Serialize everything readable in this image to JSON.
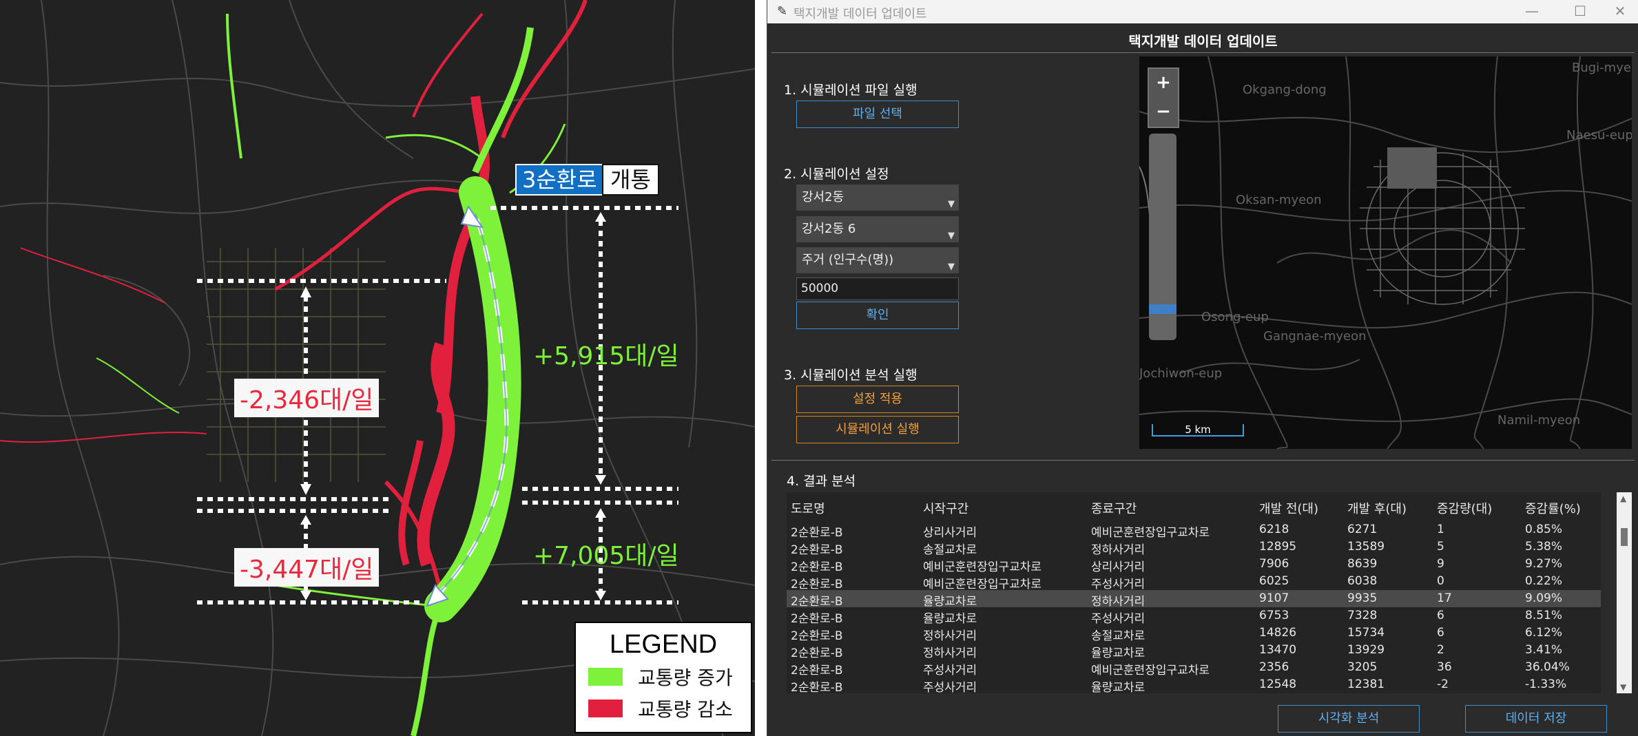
{
  "traffic_map": {
    "callout_route_name": "3순환로",
    "callout_status": "개통",
    "increase_north": "+5,915대/일",
    "increase_south": "+7,005대/일",
    "decrease_north": "-2,346대/일",
    "decrease_south": "-3,447대/일",
    "legend": {
      "title": "LEGEND",
      "increase_label": "교통량 증가",
      "decrease_label": "교통량 감소",
      "increase_color": "#7ef23a",
      "decrease_color": "#e0203c"
    }
  },
  "window": {
    "title": "택지개발 데이터 업데이트",
    "header": "택지개발 데이터 업데이트",
    "controls": [
      "—",
      "☐",
      "✕"
    ]
  },
  "step1": {
    "label": "1. 시뮬레이션 파일 실행",
    "button": "파일 선택"
  },
  "step2": {
    "label": "2. 시뮬레이션 설정",
    "dropdown1": "강서2동",
    "dropdown2": "강서2동 6",
    "dropdown3": "주거 (인구수(명))",
    "input_value": "50000",
    "confirm_button": "확인"
  },
  "step3": {
    "label": "3. 시뮬레이션 분석 실행",
    "apply_button": "설정 적용",
    "run_button": "시뮬레이션 실행"
  },
  "map_panel": {
    "zoom_in": "+",
    "zoom_out": "−",
    "scale": "5 km",
    "place_labels": [
      "Bugi-myeon",
      "Okgang-dong",
      "Naesu-eup",
      "Oksan-myeon",
      "Osong-eup",
      "Gangnae-myeon",
      "Jochiwon-eup",
      "Namil-myeon"
    ]
  },
  "results": {
    "label": "4. 결과 분석",
    "headers": [
      "도로명",
      "시작구간",
      "종료구간",
      "개발 전(대)",
      "개발 후(대)",
      "증감량(대)",
      "증감률(%)"
    ],
    "rows": [
      [
        "2순환로-B",
        "상리사거리",
        "예비군훈련장입구교차로",
        "6218",
        "6271",
        "1",
        "0.85%"
      ],
      [
        "2순환로-B",
        "송절교차로",
        "정하사거리",
        "12895",
        "13589",
        "5",
        "5.38%"
      ],
      [
        "2순환로-B",
        "예비군훈련장입구교차로",
        "상리사거리",
        "7906",
        "8639",
        "9",
        "9.27%"
      ],
      [
        "2순환로-B",
        "예비군훈련장입구교차로",
        "주성사거리",
        "6025",
        "6038",
        "0",
        "0.22%"
      ],
      [
        "2순환로-B",
        "율량교차로",
        "정하사거리",
        "9107",
        "9935",
        "17",
        "9.09%"
      ],
      [
        "2순환로-B",
        "율량교차로",
        "주성사거리",
        "6753",
        "7328",
        "6",
        "8.51%"
      ],
      [
        "2순환로-B",
        "정하사거리",
        "송절교차로",
        "14826",
        "15734",
        "6",
        "6.12%"
      ],
      [
        "2순환로-B",
        "정하사거리",
        "율량교차로",
        "13470",
        "13929",
        "2",
        "3.41%"
      ],
      [
        "2순환로-B",
        "주성사거리",
        "예비군훈련장입구교차로",
        "2356",
        "3205",
        "36",
        "36.04%"
      ],
      [
        "2순환로-B",
        "주성사거리",
        "율량교차로",
        "12548",
        "12381",
        "-2",
        "-1.33%"
      ]
    ],
    "selected_row": 4
  },
  "footer": {
    "visualize_button": "시각화 분석",
    "save_button": "데이터 저장"
  }
}
